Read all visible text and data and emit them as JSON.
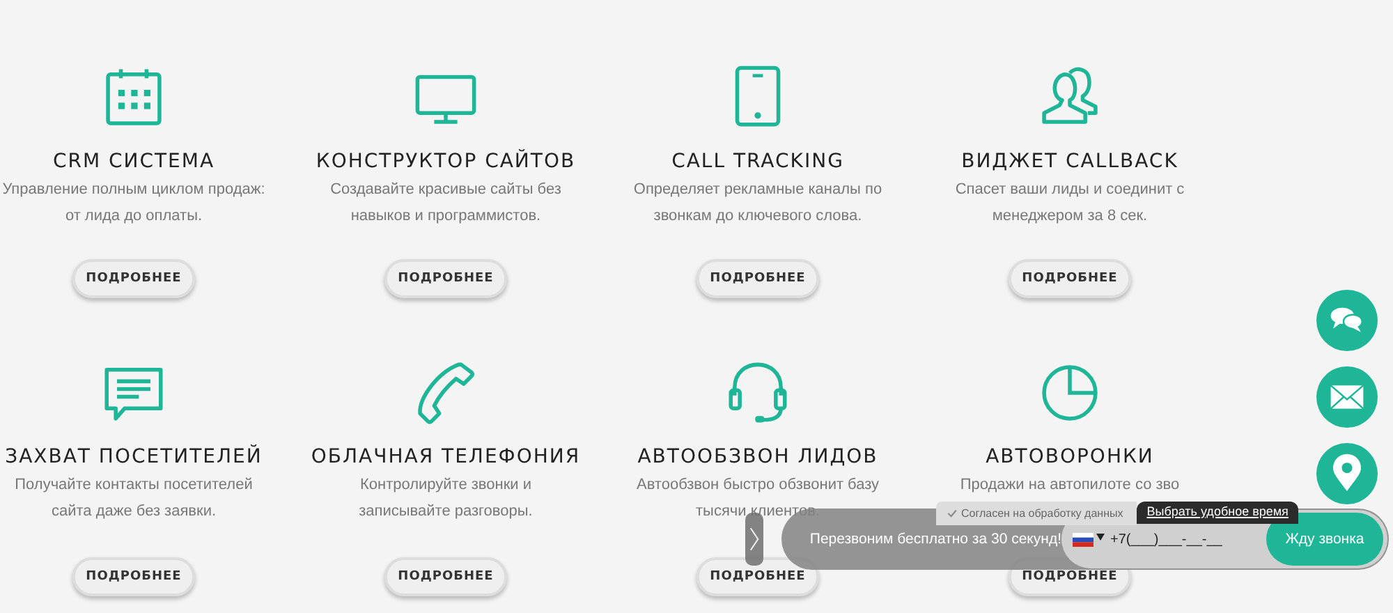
{
  "cards": [
    {
      "title": "CRM СИСТЕМА",
      "description": "Управление полным циклом продаж:\nот лида до оплаты.",
      "button": "ПОДРОБНЕЕ"
    },
    {
      "title": "КОНСТРУКТОР САЙТОВ",
      "description": "Создавайте красивые сайты без\nнавыков и программистов.",
      "button": "ПОДРОБНЕЕ"
    },
    {
      "title": "CALL TRACKING",
      "description": "Определяет рекламные каналы по\nзвонкам до ключевого слова.",
      "button": "ПОДРОБНЕЕ"
    },
    {
      "title": "ВИДЖЕТ CALLBACK",
      "description": "Спасет ваши лиды и соединит с\nменеджером за 8 сек.",
      "button": "ПОДРОБНЕЕ"
    },
    {
      "title": "ЗАХВАТ ПОСЕТИТЕЛЕЙ",
      "description": "Получайте контакты посетителей\nсайта даже без заявки.",
      "button": "ПОДРОБНЕЕ"
    },
    {
      "title": "ОБЛАЧНАЯ ТЕЛЕФОНИЯ",
      "description": "Контролируйте звонки и\nзаписывайте разговоры.",
      "button": "ПОДРОБНЕЕ"
    },
    {
      "title": "АВТООБЗВОН ЛИДОВ",
      "description": "Автообзвон быстро обзвонит базу\nтысячи клиентов.",
      "button": "ПОДРОБНЕЕ"
    },
    {
      "title": "АВТОВОРОНКИ",
      "description": "Продажи на автопилоте со зво",
      "button": "ПОДРОБНЕЕ"
    }
  ],
  "side_buttons": [
    {
      "kind": "chat"
    },
    {
      "kind": "mail"
    },
    {
      "kind": "pin"
    }
  ],
  "callback_widget": {
    "consent": {
      "label": "Согласен на обработку данных",
      "checked": true
    },
    "time_link": "Выбрать удобное время",
    "message": "Перезвоним бесплатно за 30 секунд!",
    "phone": {
      "placeholder": "+7(___)___-__-__"
    },
    "submit": "Жду звонка"
  }
}
